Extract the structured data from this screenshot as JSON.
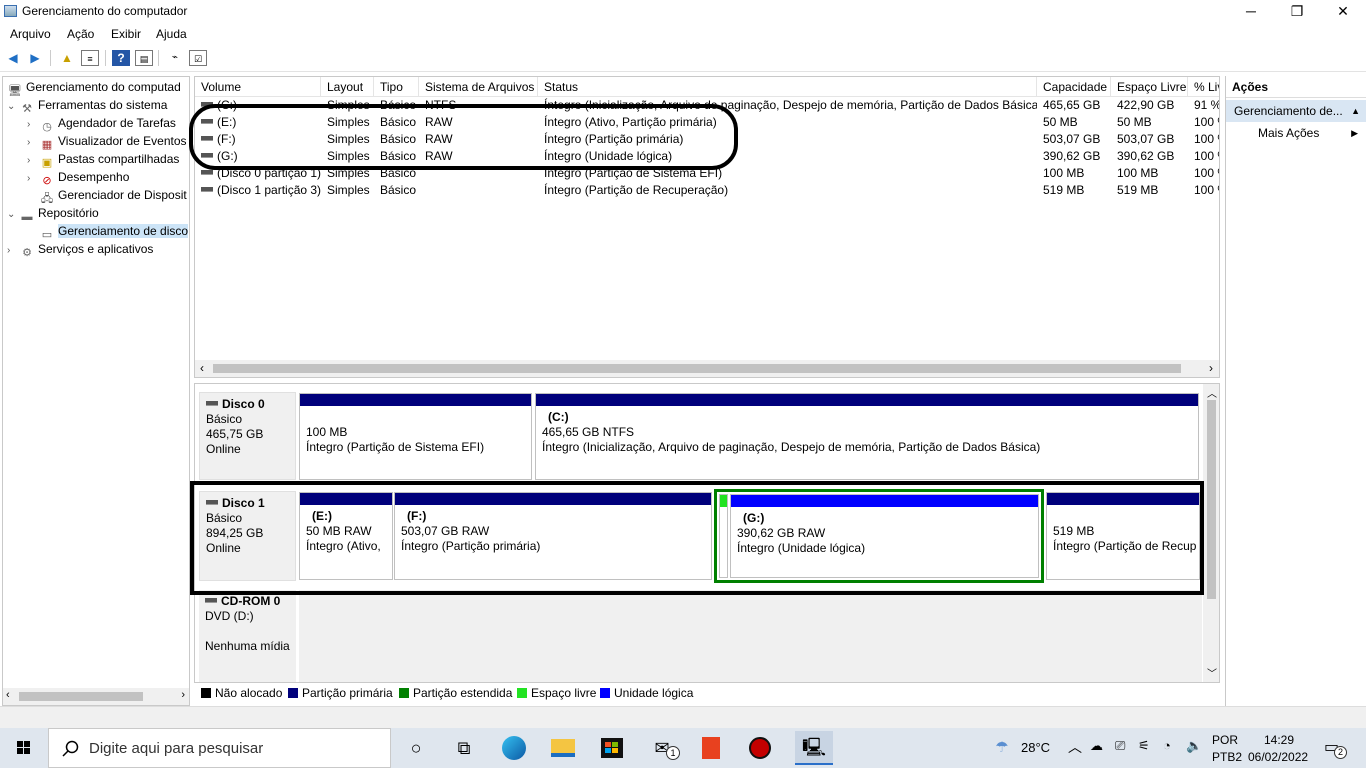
{
  "window": {
    "title": "Gerenciamento do computador",
    "minimize": "─",
    "maximize": "❐",
    "close": "✕"
  },
  "menu": [
    "Arquivo",
    "Ação",
    "Exibir",
    "Ajuda"
  ],
  "tree": [
    {
      "label": "Gerenciamento do computad",
      "icon": "computer-icon",
      "arrow": ""
    },
    {
      "label": "Ferramentas do sistema",
      "icon": "tools-icon",
      "arrow": "⌄"
    },
    {
      "label": "Agendador de Tarefas",
      "icon": "clock-icon",
      "arrow": "›"
    },
    {
      "label": "Visualizador de Eventos",
      "icon": "event-viewer-icon",
      "arrow": "›"
    },
    {
      "label": "Pastas compartilhadas",
      "icon": "shared-folder-icon",
      "arrow": "›"
    },
    {
      "label": "Desempenho",
      "icon": "performance-icon",
      "arrow": "›"
    },
    {
      "label": "Gerenciador de Disposit",
      "icon": "device-manager-icon",
      "arrow": ""
    },
    {
      "label": "Repositório",
      "icon": "storage-icon",
      "arrow": "⌄"
    },
    {
      "label": "Gerenciamento de disco",
      "icon": "disk-icon",
      "arrow": ""
    },
    {
      "label": "Serviços e aplicativos",
      "icon": "services-icon",
      "arrow": "›"
    }
  ],
  "columns": [
    "Volume",
    "Layout",
    "Tipo",
    "Sistema de Arquivos",
    "Status",
    "Capacidade",
    "Espaço Livre",
    "% Liv"
  ],
  "volumes": [
    [
      "(C:)",
      "Simples",
      "Básico",
      "NTFS",
      "Íntegro (Inicialização, Arquivo de paginação, Despejo de memória, Partição de Dados Básica)",
      "465,65 GB",
      "422,90 GB",
      "91 %"
    ],
    [
      "(E:)",
      "Simples",
      "Básico",
      "RAW",
      "Íntegro (Ativo, Partição primária)",
      "50 MB",
      "50 MB",
      "100 %"
    ],
    [
      "(F:)",
      "Simples",
      "Básico",
      "RAW",
      "Íntegro (Partição primária)",
      "503,07 GB",
      "503,07 GB",
      "100 %"
    ],
    [
      "(G:)",
      "Simples",
      "Básico",
      "RAW",
      "Íntegro (Unidade lógica)",
      "390,62 GB",
      "390,62 GB",
      "100 %"
    ],
    [
      "(Disco 0 partição 1)",
      "Simples",
      "Básico",
      "",
      "Íntegro (Partição de Sistema EFI)",
      "100 MB",
      "100 MB",
      "100 %"
    ],
    [
      "(Disco 1 partição 3)",
      "Simples",
      "Básico",
      "",
      "Íntegro (Partição de Recuperação)",
      "519 MB",
      "519 MB",
      "100 %"
    ]
  ],
  "disks": [
    {
      "name": "Disco 0",
      "type": "Básico",
      "size": "465,75 GB",
      "state": "Online",
      "parts": [
        {
          "title": "",
          "size": "100 MB",
          "status": "Íntegro (Partição de Sistema EFI)"
        },
        {
          "title": "(C:)",
          "size": "465,65 GB NTFS",
          "status": "Íntegro (Inicialização, Arquivo de paginação, Despejo de memória, Partição de Dados Básica)"
        }
      ]
    },
    {
      "name": "Disco 1",
      "type": "Básico",
      "size": "894,25 GB",
      "state": "Online",
      "parts": [
        {
          "title": "(E:)",
          "size": "50 MB RAW",
          "status": "Íntegro (Ativo,"
        },
        {
          "title": "(F:)",
          "size": "503,07 GB RAW",
          "status": "Íntegro (Partição primária)"
        },
        {
          "title": "(G:)",
          "size": "390,62 GB RAW",
          "status": "Íntegro (Unidade lógica)"
        },
        {
          "title": "",
          "size": "519 MB",
          "status": "Íntegro (Partição de Recup"
        }
      ]
    },
    {
      "name": "CD-ROM 0",
      "type": "DVD (D:)",
      "size": "",
      "state": "Nenhuma mídia",
      "parts": []
    }
  ],
  "legend": [
    {
      "label": "Não alocado",
      "color": "#000000"
    },
    {
      "label": "Partição primária",
      "color": "#00007b"
    },
    {
      "label": "Partição estendida",
      "color": "#008000"
    },
    {
      "label": "Espaço livre",
      "color": "#22e322"
    },
    {
      "label": "Unidade lógica",
      "color": "#0000ff"
    }
  ],
  "actions": {
    "header": "Ações",
    "section": "Gerenciamento de...",
    "more": "Mais Ações"
  },
  "taskbar": {
    "search_placeholder": "Digite aqui para pesquisar",
    "temperature": "28°C",
    "lang1": "POR",
    "lang2": "PTB2",
    "time": "14:29",
    "date": "06/02/2022",
    "notif_count": "2",
    "mail_badge": "1"
  }
}
